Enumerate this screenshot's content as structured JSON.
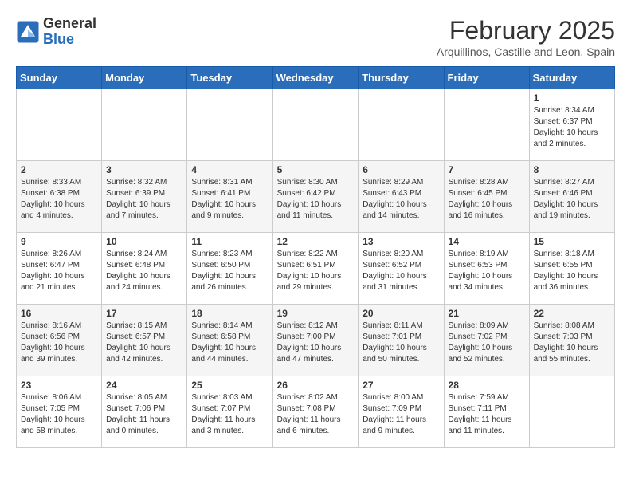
{
  "header": {
    "logo_general": "General",
    "logo_blue": "Blue",
    "month_title": "February 2025",
    "location": "Arquillinos, Castille and Leon, Spain"
  },
  "columns": [
    "Sunday",
    "Monday",
    "Tuesday",
    "Wednesday",
    "Thursday",
    "Friday",
    "Saturday"
  ],
  "weeks": [
    {
      "days": [
        {
          "num": "",
          "info": ""
        },
        {
          "num": "",
          "info": ""
        },
        {
          "num": "",
          "info": ""
        },
        {
          "num": "",
          "info": ""
        },
        {
          "num": "",
          "info": ""
        },
        {
          "num": "",
          "info": ""
        },
        {
          "num": "1",
          "info": "Sunrise: 8:34 AM\nSunset: 6:37 PM\nDaylight: 10 hours\nand 2 minutes."
        }
      ]
    },
    {
      "days": [
        {
          "num": "2",
          "info": "Sunrise: 8:33 AM\nSunset: 6:38 PM\nDaylight: 10 hours\nand 4 minutes."
        },
        {
          "num": "3",
          "info": "Sunrise: 8:32 AM\nSunset: 6:39 PM\nDaylight: 10 hours\nand 7 minutes."
        },
        {
          "num": "4",
          "info": "Sunrise: 8:31 AM\nSunset: 6:41 PM\nDaylight: 10 hours\nand 9 minutes."
        },
        {
          "num": "5",
          "info": "Sunrise: 8:30 AM\nSunset: 6:42 PM\nDaylight: 10 hours\nand 11 minutes."
        },
        {
          "num": "6",
          "info": "Sunrise: 8:29 AM\nSunset: 6:43 PM\nDaylight: 10 hours\nand 14 minutes."
        },
        {
          "num": "7",
          "info": "Sunrise: 8:28 AM\nSunset: 6:45 PM\nDaylight: 10 hours\nand 16 minutes."
        },
        {
          "num": "8",
          "info": "Sunrise: 8:27 AM\nSunset: 6:46 PM\nDaylight: 10 hours\nand 19 minutes."
        }
      ]
    },
    {
      "days": [
        {
          "num": "9",
          "info": "Sunrise: 8:26 AM\nSunset: 6:47 PM\nDaylight: 10 hours\nand 21 minutes."
        },
        {
          "num": "10",
          "info": "Sunrise: 8:24 AM\nSunset: 6:48 PM\nDaylight: 10 hours\nand 24 minutes."
        },
        {
          "num": "11",
          "info": "Sunrise: 8:23 AM\nSunset: 6:50 PM\nDaylight: 10 hours\nand 26 minutes."
        },
        {
          "num": "12",
          "info": "Sunrise: 8:22 AM\nSunset: 6:51 PM\nDaylight: 10 hours\nand 29 minutes."
        },
        {
          "num": "13",
          "info": "Sunrise: 8:20 AM\nSunset: 6:52 PM\nDaylight: 10 hours\nand 31 minutes."
        },
        {
          "num": "14",
          "info": "Sunrise: 8:19 AM\nSunset: 6:53 PM\nDaylight: 10 hours\nand 34 minutes."
        },
        {
          "num": "15",
          "info": "Sunrise: 8:18 AM\nSunset: 6:55 PM\nDaylight: 10 hours\nand 36 minutes."
        }
      ]
    },
    {
      "days": [
        {
          "num": "16",
          "info": "Sunrise: 8:16 AM\nSunset: 6:56 PM\nDaylight: 10 hours\nand 39 minutes."
        },
        {
          "num": "17",
          "info": "Sunrise: 8:15 AM\nSunset: 6:57 PM\nDaylight: 10 hours\nand 42 minutes."
        },
        {
          "num": "18",
          "info": "Sunrise: 8:14 AM\nSunset: 6:58 PM\nDaylight: 10 hours\nand 44 minutes."
        },
        {
          "num": "19",
          "info": "Sunrise: 8:12 AM\nSunset: 7:00 PM\nDaylight: 10 hours\nand 47 minutes."
        },
        {
          "num": "20",
          "info": "Sunrise: 8:11 AM\nSunset: 7:01 PM\nDaylight: 10 hours\nand 50 minutes."
        },
        {
          "num": "21",
          "info": "Sunrise: 8:09 AM\nSunset: 7:02 PM\nDaylight: 10 hours\nand 52 minutes."
        },
        {
          "num": "22",
          "info": "Sunrise: 8:08 AM\nSunset: 7:03 PM\nDaylight: 10 hours\nand 55 minutes."
        }
      ]
    },
    {
      "days": [
        {
          "num": "23",
          "info": "Sunrise: 8:06 AM\nSunset: 7:05 PM\nDaylight: 10 hours\nand 58 minutes."
        },
        {
          "num": "24",
          "info": "Sunrise: 8:05 AM\nSunset: 7:06 PM\nDaylight: 11 hours\nand 0 minutes."
        },
        {
          "num": "25",
          "info": "Sunrise: 8:03 AM\nSunset: 7:07 PM\nDaylight: 11 hours\nand 3 minutes."
        },
        {
          "num": "26",
          "info": "Sunrise: 8:02 AM\nSunset: 7:08 PM\nDaylight: 11 hours\nand 6 minutes."
        },
        {
          "num": "27",
          "info": "Sunrise: 8:00 AM\nSunset: 7:09 PM\nDaylight: 11 hours\nand 9 minutes."
        },
        {
          "num": "28",
          "info": "Sunrise: 7:59 AM\nSunset: 7:11 PM\nDaylight: 11 hours\nand 11 minutes."
        },
        {
          "num": "",
          "info": ""
        }
      ]
    }
  ]
}
